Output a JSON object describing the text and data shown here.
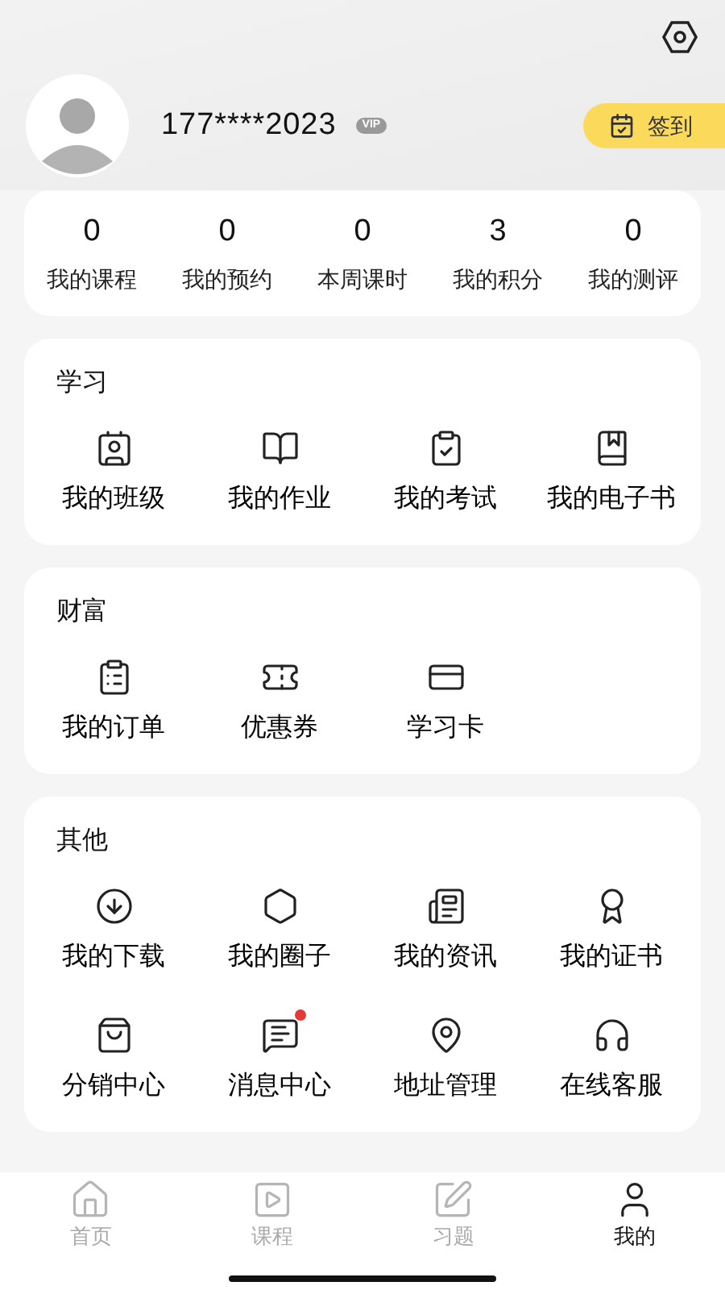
{
  "profile": {
    "phone": "177****2023",
    "vip_badge": "VIP",
    "checkin": "签到"
  },
  "stats": [
    {
      "value": "0",
      "label": "我的课程"
    },
    {
      "value": "0",
      "label": "我的预约"
    },
    {
      "value": "0",
      "label": "本周课时"
    },
    {
      "value": "3",
      "label": "我的积分"
    },
    {
      "value": "0",
      "label": "我的测评"
    }
  ],
  "sections": [
    {
      "title": "学习",
      "items": [
        {
          "label": "我的班级",
          "has_dot": false
        },
        {
          "label": "我的作业",
          "has_dot": false
        },
        {
          "label": "我的考试",
          "has_dot": false
        },
        {
          "label": "我的电子书",
          "has_dot": false
        }
      ]
    },
    {
      "title": "财富",
      "items": [
        {
          "label": "我的订单",
          "has_dot": false
        },
        {
          "label": "优惠券",
          "has_dot": false
        },
        {
          "label": "学习卡",
          "has_dot": false
        }
      ]
    },
    {
      "title": "其他",
      "items": [
        {
          "label": "我的下载",
          "has_dot": false
        },
        {
          "label": "我的圈子",
          "has_dot": false
        },
        {
          "label": "我的资讯",
          "has_dot": false
        },
        {
          "label": "我的证书",
          "has_dot": false
        },
        {
          "label": "分销中心",
          "has_dot": false
        },
        {
          "label": "消息中心",
          "has_dot": true
        },
        {
          "label": "地址管理",
          "has_dot": false
        },
        {
          "label": "在线客服",
          "has_dot": false
        }
      ]
    }
  ],
  "tab_bar": [
    {
      "label": "首页",
      "selected": false
    },
    {
      "label": "课程",
      "selected": false
    },
    {
      "label": "习题",
      "selected": false
    },
    {
      "label": "我的",
      "selected": true
    }
  ]
}
